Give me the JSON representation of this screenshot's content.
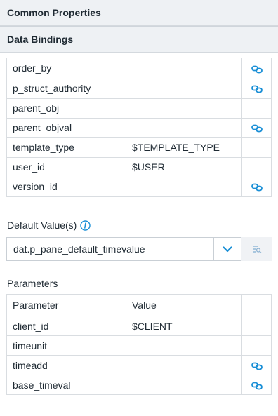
{
  "sections": {
    "common_title": "Common Properties",
    "bindings_title": "Data Bindings"
  },
  "bindings": [
    {
      "name": "order_by",
      "value": "",
      "linked": true
    },
    {
      "name": "p_struct_authority",
      "value": "",
      "linked": true
    },
    {
      "name": "parent_obj",
      "value": "",
      "linked": false
    },
    {
      "name": "parent_objval",
      "value": "",
      "linked": true
    },
    {
      "name": "template_type",
      "value": "$TEMPLATE_TYPE",
      "linked": false
    },
    {
      "name": "user_id",
      "value": "$USER",
      "linked": false
    },
    {
      "name": "version_id",
      "value": "",
      "linked": true
    }
  ],
  "default_values": {
    "label": "Default Value(s)",
    "selected": "dat.p_pane_default_timevalue"
  },
  "parameters": {
    "label": "Parameters",
    "headers": [
      "Parameter",
      "Value"
    ],
    "rows": [
      {
        "name": "client_id",
        "value": "$CLIENT",
        "linked": false
      },
      {
        "name": "timeunit",
        "value": "",
        "linked": false
      },
      {
        "name": "timeadd",
        "value": "",
        "linked": true
      },
      {
        "name": "base_timeval",
        "value": "",
        "linked": true
      }
    ]
  },
  "icons": {
    "link": "link-icon",
    "info": "info-icon",
    "dropdown": "chevron-down-icon",
    "lookup": "lookup-icon"
  },
  "colors": {
    "accent": "#1a8fd6",
    "header_bg": "#eef1f4",
    "border": "#d9dde1"
  }
}
